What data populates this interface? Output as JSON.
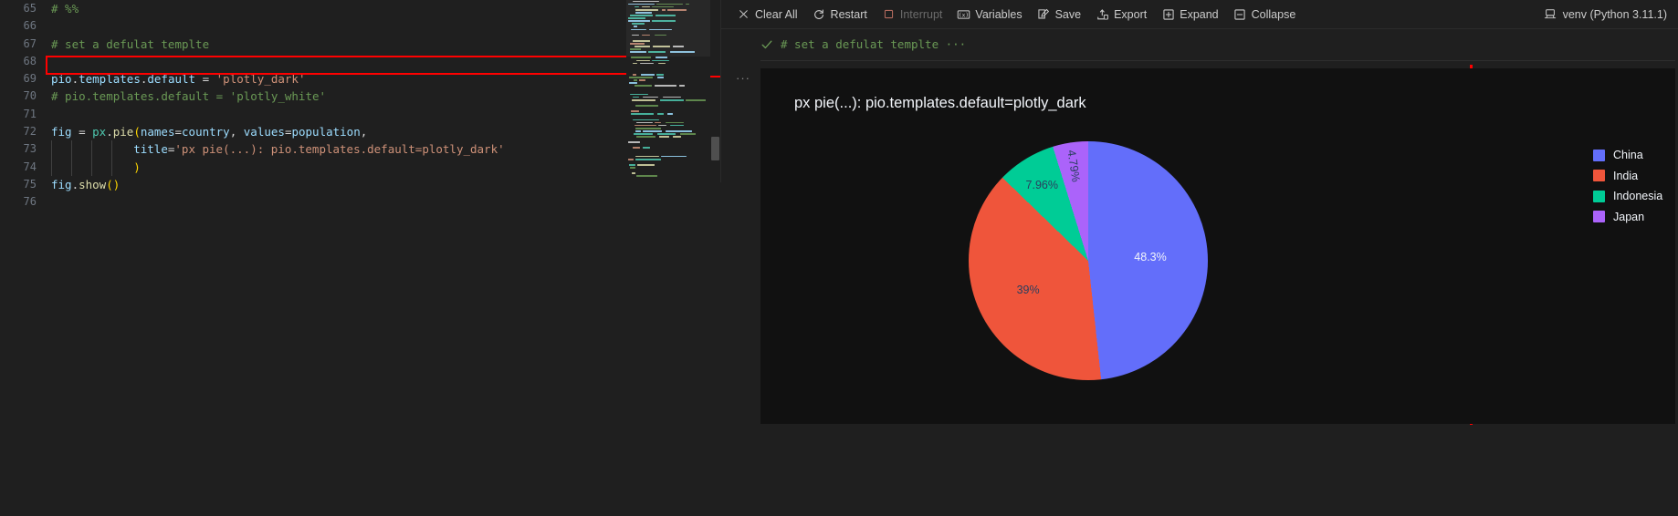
{
  "editor": {
    "lines": [
      {
        "num": "65",
        "tokens": [
          {
            "t": "# %%",
            "c": "com"
          }
        ],
        "indent": 0
      },
      {
        "num": "66",
        "tokens": [],
        "indent": 0
      },
      {
        "num": "67",
        "tokens": [
          {
            "t": "# set a defulat templte",
            "c": "com"
          }
        ],
        "indent": 0
      },
      {
        "num": "68",
        "tokens": [],
        "indent": 0
      },
      {
        "num": "69",
        "tokens": [
          {
            "t": "pio",
            "c": "var"
          },
          {
            "t": ".",
            "c": "plain"
          },
          {
            "t": "templates",
            "c": "prop"
          },
          {
            "t": ".",
            "c": "plain"
          },
          {
            "t": "default",
            "c": "prop"
          },
          {
            "t": " = ",
            "c": "op"
          },
          {
            "t": "'plotly_dark'",
            "c": "str"
          }
        ],
        "indent": 0,
        "highlighted": true
      },
      {
        "num": "70",
        "tokens": [
          {
            "t": "# pio.templates.default = 'plotly_white'",
            "c": "com"
          }
        ],
        "indent": 0
      },
      {
        "num": "71",
        "tokens": [],
        "indent": 0
      },
      {
        "num": "72",
        "tokens": [
          {
            "t": "fig",
            "c": "var"
          },
          {
            "t": " = ",
            "c": "op"
          },
          {
            "t": "px",
            "c": "mod"
          },
          {
            "t": ".",
            "c": "plain"
          },
          {
            "t": "pie",
            "c": "fn"
          },
          {
            "t": "(",
            "c": "punc"
          },
          {
            "t": "names",
            "c": "var"
          },
          {
            "t": "=",
            "c": "op"
          },
          {
            "t": "country",
            "c": "var"
          },
          {
            "t": ", ",
            "c": "plain"
          },
          {
            "t": "values",
            "c": "var"
          },
          {
            "t": "=",
            "c": "op"
          },
          {
            "t": "population",
            "c": "var"
          },
          {
            "t": ",",
            "c": "plain"
          }
        ],
        "indent": 0
      },
      {
        "num": "73",
        "tokens": [
          {
            "t": "title",
            "c": "var"
          },
          {
            "t": "=",
            "c": "op"
          },
          {
            "t": "'px pie(...): pio.templates.default=plotly_dark'",
            "c": "str"
          }
        ],
        "indent": 12
      },
      {
        "num": "74",
        "tokens": [
          {
            "t": ")",
            "c": "punc"
          }
        ],
        "indent": 12
      },
      {
        "num": "75",
        "tokens": [
          {
            "t": "fig",
            "c": "var"
          },
          {
            "t": ".",
            "c": "plain"
          },
          {
            "t": "show",
            "c": "fn"
          },
          {
            "t": "(",
            "c": "punc"
          },
          {
            "t": ")",
            "c": "punc"
          }
        ],
        "indent": 0
      },
      {
        "num": "76",
        "tokens": [],
        "indent": 0
      }
    ]
  },
  "toolbar": {
    "clear_all": "Clear All",
    "restart": "Restart",
    "interrupt": "Interrupt",
    "variables": "Variables",
    "save": "Save",
    "export": "Export",
    "expand": "Expand",
    "collapse": "Collapse",
    "kernel": "venv (Python 3.11.1)"
  },
  "cell": {
    "header": "# set a defulat templte ···",
    "dots": "···"
  },
  "colors": {
    "annotation": "#ff0000",
    "plot_bg": "#111111",
    "china": "#636efa",
    "india": "#ef553b",
    "indonesia": "#00cc96",
    "japan": "#ab63fa"
  },
  "chart_data": {
    "type": "pie",
    "title": "px pie(...): pio.templates.default=plotly_dark",
    "template": "plotly_dark",
    "paper_bgcolor": "#111111",
    "categories": [
      "China",
      "India",
      "Indonesia",
      "Japan"
    ],
    "values": [
      48.3,
      39.0,
      7.96,
      4.79
    ],
    "labels": [
      "48.3%",
      "39%",
      "7.96%",
      "4.79%"
    ],
    "colors": [
      "#636efa",
      "#ef553b",
      "#00cc96",
      "#ab63fa"
    ],
    "legend_title": "",
    "legend_position": "right",
    "xlabel": "",
    "ylabel": "",
    "grid": false,
    "legend": [
      {
        "label": "China",
        "color": "#636efa"
      },
      {
        "label": "India",
        "color": "#ef553b"
      },
      {
        "label": "Indonesia",
        "color": "#00cc96"
      },
      {
        "label": "Japan",
        "color": "#ab63fa"
      }
    ]
  }
}
